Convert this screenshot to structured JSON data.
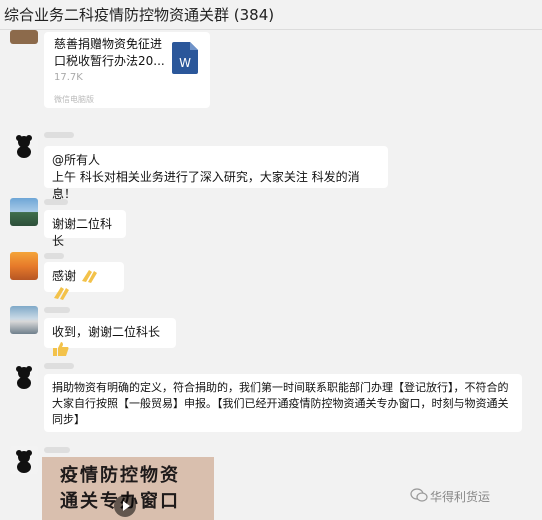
{
  "header": {
    "title": "综合业务二科疫情防控物资通关群 (384)"
  },
  "file_message": {
    "title": "慈善捐赠物资免征进口税收暂行办法20...",
    "size": "17.7K",
    "source": "微信电脑版",
    "icon_letter": "W"
  },
  "messages": [
    {
      "line1": "@所有人",
      "line2": "上午 科长对相关业务进行了深入研究，大家关注 科发的消息！"
    },
    {
      "text": "谢谢二位科长"
    },
    {
      "text": "感谢"
    },
    {
      "text": "收到，谢谢二位科长"
    },
    {
      "lines": [
        "捐助物资有明确的定义，符合捐助的，我们第一时间联系职能部门办理【登记放行】，不符合的",
        "大家自行按照【一般贸易】申报。【我们已经开通疫情防控物资通关专办窗口，时刻与物资通关",
        "同步】"
      ]
    }
  ],
  "image_message": {
    "sign_line1": "疫情防控物资",
    "sign_line2": "通关专办窗口"
  },
  "watermark": {
    "text": "华得利货运"
  },
  "colors": {
    "background": "#f2f2f2",
    "bubble": "#ffffff",
    "word_icon": "#2b579a"
  }
}
